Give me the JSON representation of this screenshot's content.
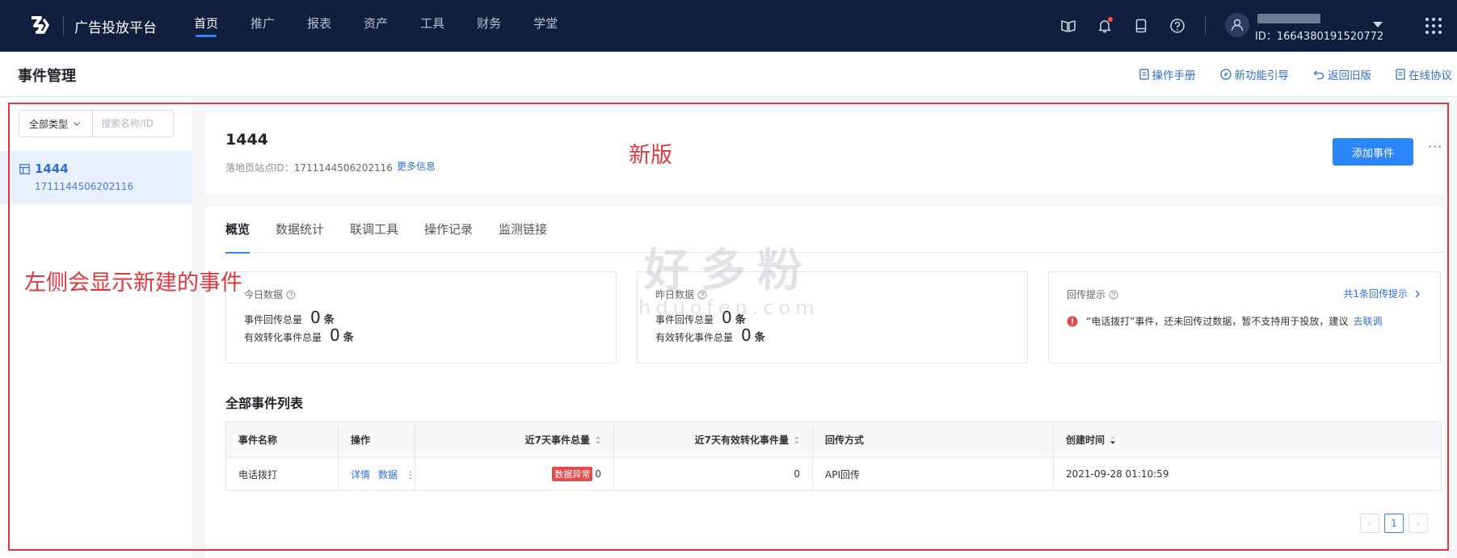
{
  "topbar": {
    "brand": "广告投放平台",
    "nav": [
      "首页",
      "推广",
      "报表",
      "资产",
      "工具",
      "财务",
      "学堂"
    ],
    "active_index": 0,
    "user_id": "ID：1664380191520772",
    "icons": [
      "book-icon",
      "bell-icon",
      "tablet-icon",
      "help-icon"
    ]
  },
  "page": {
    "title": "事件管理",
    "links": [
      "操作手册",
      "新功能引导",
      "返回旧版",
      "在线协议"
    ]
  },
  "sidebar": {
    "type_select": "全部类型",
    "search_placeholder": "搜索名称/ID",
    "items": [
      {
        "name": "1444",
        "id": "1711144506202116"
      }
    ]
  },
  "event": {
    "title": "1444",
    "site_label": "落地页站点ID：",
    "site_id": "1711144506202116",
    "more_info": "更多信息",
    "add_button": "添加事件",
    "more_button": "···"
  },
  "tabs": [
    "概览",
    "数据统计",
    "联调工具",
    "操作记录",
    "监测链接"
  ],
  "today": {
    "title": "今日数据",
    "total_label": "事件回传总量",
    "total_value": "0",
    "valid_label": "有效转化事件总量",
    "valid_value": "0",
    "unit": "条"
  },
  "yesterday": {
    "title": "昨日数据",
    "total_label": "事件回传总量",
    "total_value": "0",
    "valid_label": "有效转化事件总量",
    "valid_value": "0",
    "unit": "条"
  },
  "hint": {
    "title": "回传提示",
    "count_link": "共1条回传提示",
    "message": "“电话拨打”事件，还未回传过数据，暂不支持用于投放，建议",
    "action": "去联调"
  },
  "list": {
    "title": "全部事件列表",
    "headers": [
      "事件名称",
      "操作",
      "近7天事件总量",
      "近7天有效转化事件量",
      "回传方式",
      "创建时间"
    ],
    "rows": [
      {
        "name": "电话拨打",
        "op_detail": "详情",
        "op_data": "数据",
        "op_more": "⋮",
        "tag": "数据异常",
        "total7": "0",
        "valid7": "0",
        "method": "API回传",
        "created": "2021-09-28 01:10:59"
      }
    ]
  },
  "pager": {
    "prev": "‹",
    "current": "1",
    "next": "›"
  },
  "annotations": {
    "new_version": "新版",
    "left_note": "左侧会显示新建的事件",
    "watermark_big": "好多粉",
    "watermark_small": "hduofen.com"
  },
  "colors": {
    "topbar_bg": "#0f1f3d",
    "accent": "#2d86f7",
    "annotation_red": "#e0383e",
    "abnormal_tag": "#e34b4b"
  }
}
